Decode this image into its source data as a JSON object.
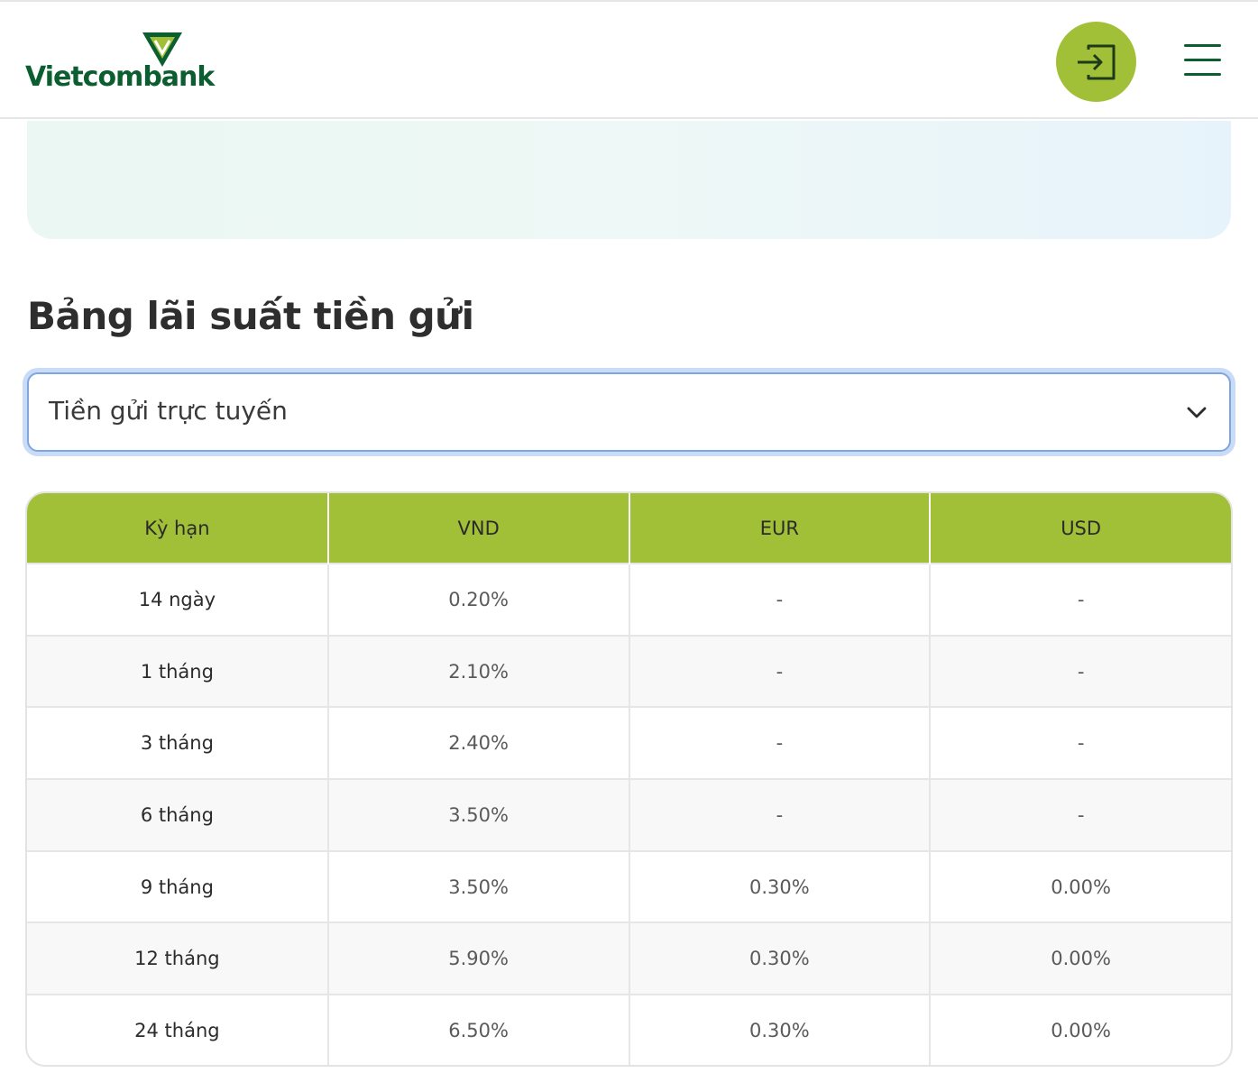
{
  "header": {
    "brand": "Vietcombank",
    "brand_color": "#0b5e2f",
    "accent_color": "#a2bf38",
    "login_icon": "login-icon",
    "menu_icon": "hamburger-menu-icon"
  },
  "section": {
    "title": "Bảng lãi suất tiền gửi"
  },
  "select": {
    "value": "Tiền gửi trực tuyến",
    "icon": "chevron-down-icon"
  },
  "table": {
    "headers": [
      "Kỳ hạn",
      "VND",
      "EUR",
      "USD"
    ],
    "rows": [
      [
        "14 ngày",
        "0.20%",
        "-",
        "-"
      ],
      [
        "1 tháng",
        "2.10%",
        "-",
        "-"
      ],
      [
        "3 tháng",
        "2.40%",
        "-",
        "-"
      ],
      [
        "6 tháng",
        "3.50%",
        "-",
        "-"
      ],
      [
        "9 tháng",
        "3.50%",
        "0.30%",
        "0.00%"
      ],
      [
        "12 tháng",
        "5.90%",
        "0.30%",
        "0.00%"
      ],
      [
        "24 tháng",
        "6.50%",
        "0.30%",
        "0.00%"
      ]
    ]
  }
}
